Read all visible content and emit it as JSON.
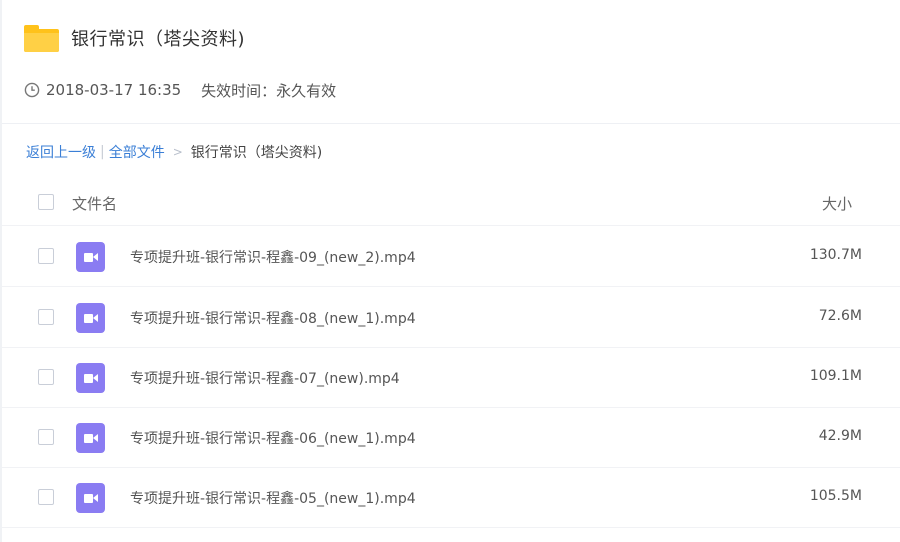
{
  "header": {
    "title": "银行常识（塔尖资料)",
    "icon": "folder-icon"
  },
  "meta": {
    "date": "2018-03-17 16:35",
    "expiry": "失效时间：永久有效",
    "icon": "clock-icon"
  },
  "breadcrumb": {
    "back": "返回上一级",
    "separator": "|",
    "all_files": "全部文件",
    "arrow": ">",
    "current": "银行常识（塔尖资料)"
  },
  "list": {
    "col_name": "文件名",
    "col_size": "大小",
    "rows": [
      {
        "name": "专项提升班-银行常识-程鑫-09_(new_2).mp4",
        "size": "130.7M"
      },
      {
        "name": "专项提升班-银行常识-程鑫-08_(new_1).mp4",
        "size": "72.6M"
      },
      {
        "name": "专项提升班-银行常识-程鑫-07_(new).mp4",
        "size": "109.1M"
      },
      {
        "name": "专项提升班-银行常识-程鑫-06_(new_1).mp4",
        "size": "42.9M"
      },
      {
        "name": "专项提升班-银行常识-程鑫-05_(new_1).mp4",
        "size": "105.5M"
      }
    ]
  },
  "colors": {
    "link": "#3b7fd6",
    "folder": "#ffc21a",
    "video_icon": "#8a7cf2"
  }
}
